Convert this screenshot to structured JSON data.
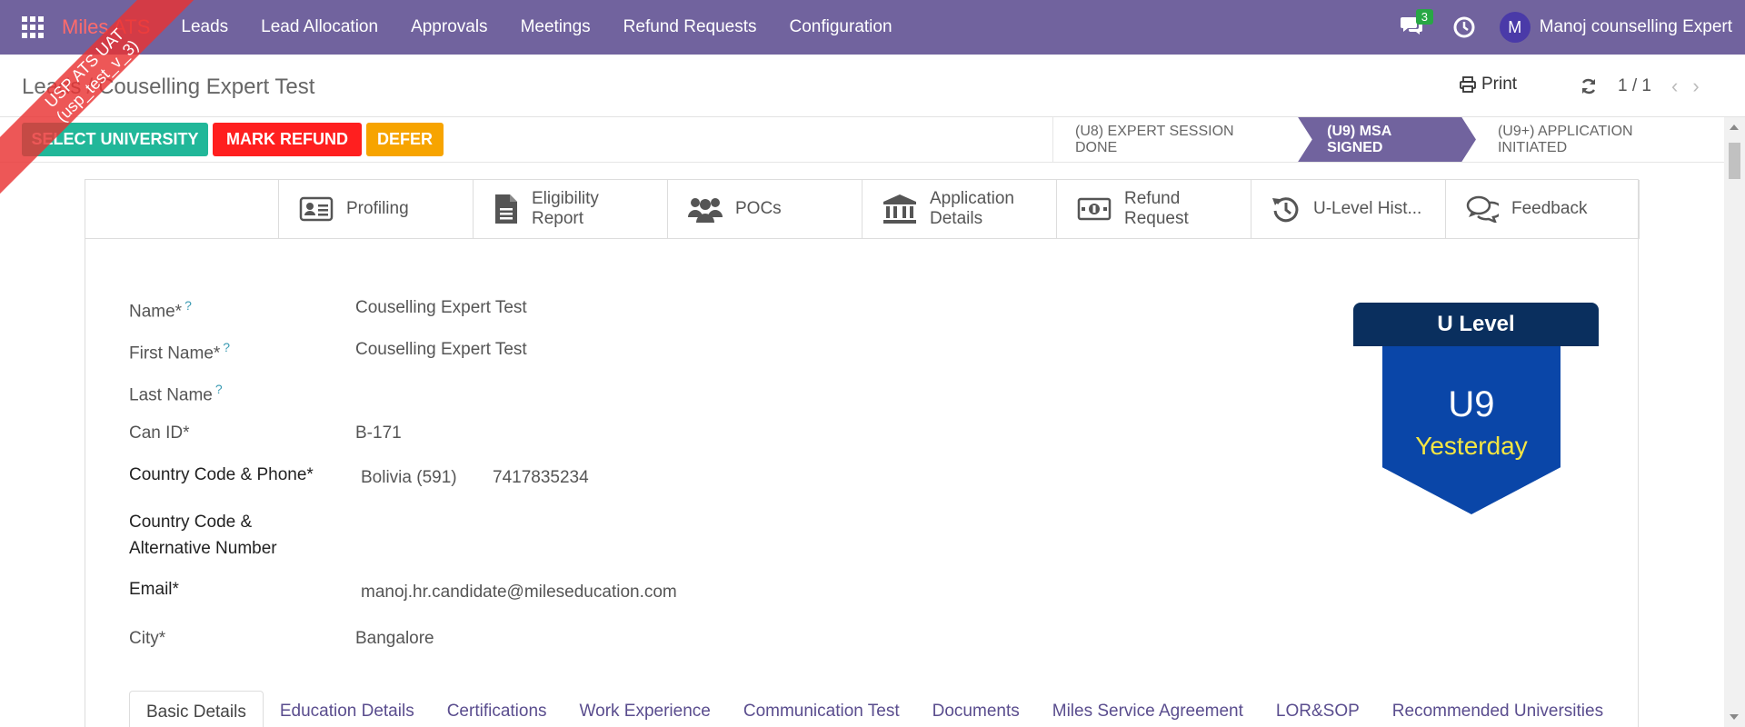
{
  "navbar": {
    "brand": "Miles ATS",
    "menu": [
      "Leads",
      "Lead Allocation",
      "Approvals",
      "Meetings",
      "Refund Requests",
      "Configuration"
    ],
    "chat_count": "3",
    "avatar_letter": "M",
    "user_name": "Manoj counselling Expert"
  },
  "ribbon": {
    "line1": "USP ATS UAT",
    "line2": "(usp_test_v_3)"
  },
  "breadcrumb": {
    "parent": "Leads",
    "separator": "/",
    "current": "Couselling Expert Test"
  },
  "control": {
    "print_label": "Print",
    "pager": "1 / 1"
  },
  "actions": {
    "select_university": "SELECT UNIVERSITY",
    "mark_refund": "MARK REFUND",
    "defer": "DEFER"
  },
  "statusbar": {
    "stages": [
      "(U8) EXPERT SESSION DONE",
      "(U9) MSA SIGNED",
      "(U9+) APPLICATION INITIATED"
    ],
    "active_index": 1
  },
  "button_box": [
    {
      "icon": "profile-card-icon",
      "label1": "Profiling",
      "label2": ""
    },
    {
      "icon": "document-icon",
      "label1": "Eligibility",
      "label2": "Report"
    },
    {
      "icon": "users-icon",
      "label1": "POCs",
      "label2": ""
    },
    {
      "icon": "bank-icon",
      "label1": "Application",
      "label2": "Details"
    },
    {
      "icon": "money-icon",
      "label1": "Refund",
      "label2": "Request"
    },
    {
      "icon": "history-icon",
      "label1": "U-Level Hist...",
      "label2": ""
    },
    {
      "icon": "comments-icon",
      "label1": "Feedback",
      "label2": ""
    }
  ],
  "form": {
    "name_label": "Name*",
    "name_value": "Couselling Expert Test",
    "first_name_label": "First Name*",
    "first_name_value": "Couselling Expert Test",
    "last_name_label": "Last Name",
    "last_name_value": "",
    "can_id_label": "Can ID*",
    "can_id_value": "B-171",
    "phone_label": "Country Code & Phone*",
    "phone_country": "Bolivia (591)",
    "phone_number": "7417835234",
    "alt_label_1": "Country Code &",
    "alt_label_2": "Alternative Number",
    "email_label": "Email*",
    "email_value": "manoj.hr.candidate@mileseducation.com",
    "city_label": "City*",
    "city_value": "Bangalore",
    "help_mark": "?"
  },
  "u_level": {
    "title": "U Level",
    "level": "U9",
    "when": "Yesterday"
  },
  "tabs": [
    "Basic Details",
    "Education Details",
    "Certifications",
    "Work Experience",
    "Communication Test",
    "Documents",
    "Miles Service Agreement",
    "LOR&SOP",
    "Recommended Universities"
  ],
  "colors": {
    "navbar": "#71639e",
    "select_university": "#21b799",
    "mark_refund": "#ff1f1f",
    "defer": "#f7a400",
    "ulevel_head": "#0a2f5e",
    "ulevel_body": "#0a46a8",
    "ulevel_when": "#f5e642"
  }
}
